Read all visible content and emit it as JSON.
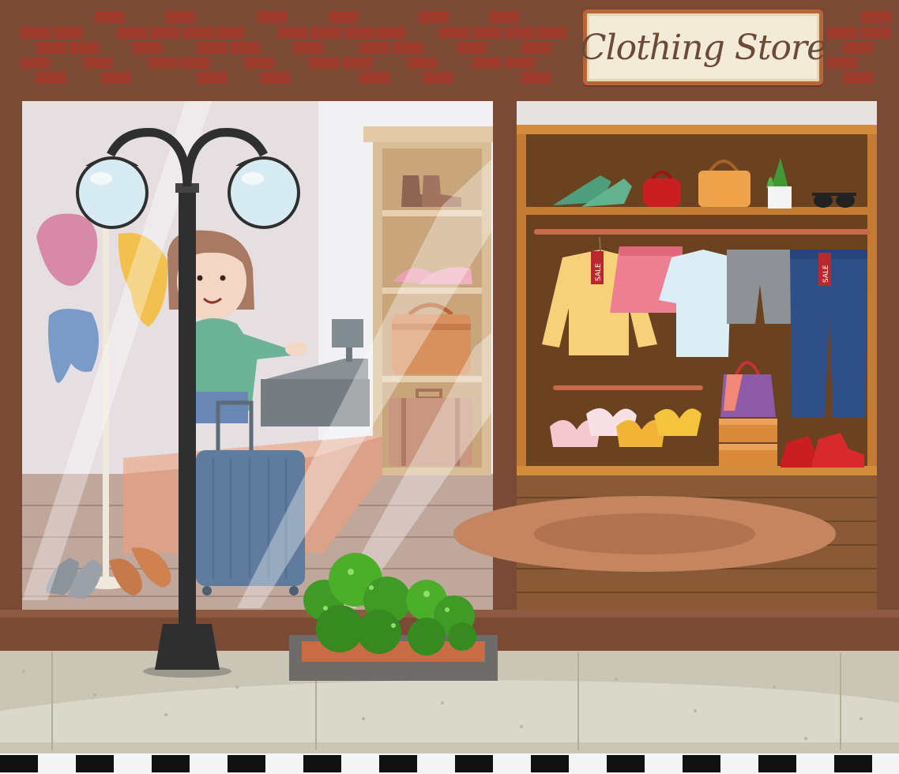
{
  "sign": {
    "text": "Clothing Store"
  },
  "tags": {
    "sale": "SALE"
  },
  "colors": {
    "brick_wall": "#7b4a34",
    "brick": "#9c3a2c",
    "sign_border": "#b9653a",
    "sign_bg": "#f3ead7",
    "shelf_wood": "#c98a4a",
    "store_interior_dark": "#5a3518",
    "sidewalk": "#c9c6b6",
    "lamp_post": "#2f2f2f",
    "bush": "#4caf2a"
  }
}
